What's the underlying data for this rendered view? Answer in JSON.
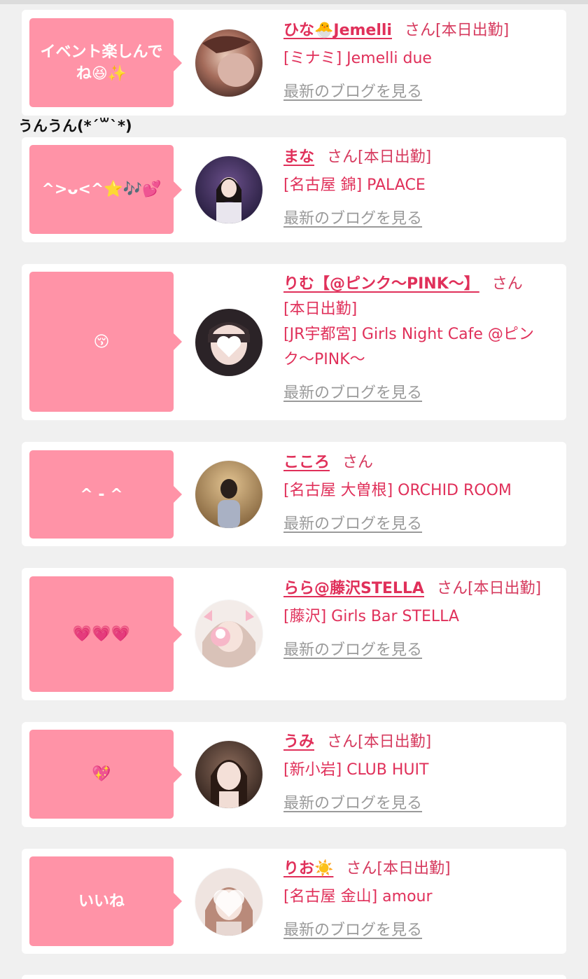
{
  "caption_overlay": "うんうん(*´꒳`*)",
  "san_label": "さん",
  "blog_link_label": "最新のブログを見る",
  "colors": {
    "bubble": "#ff93a7",
    "name": "#e0305a",
    "link_gray": "#9a9a9a",
    "background": "#f0f0f0"
  },
  "cards": [
    {
      "bubble_text": "イベント楽しんでね😆✨",
      "name": "ひな🐣Jemelli",
      "status": "[本日出勤]",
      "shop": "[ミナミ] Jemelli due"
    },
    {
      "bubble_text": "^>ᴗ<^⭐🎶💕",
      "name": "まな",
      "status": "[本日出勤]",
      "shop": "[名古屋 錦] PALACE"
    },
    {
      "bubble_text": "😚",
      "name": "りむ【@ピンク〜PINK〜】",
      "status": "[本日出勤]",
      "shop": "[JR宇都宮] Girls Night Cafe @ピンク〜PINK〜"
    },
    {
      "bubble_text": "^ - ^",
      "name": "こころ",
      "status": "",
      "shop": "[名古屋 大曽根] ORCHID ROOM"
    },
    {
      "bubble_text": "💗💗💗",
      "name": "らら@藤沢STELLA",
      "status": "[本日出勤]",
      "shop": "[藤沢] Girls Bar STELLA"
    },
    {
      "bubble_text": "💖",
      "name": "うみ",
      "status": "[本日出勤]",
      "shop": "[新小岩] CLUB HUIT"
    },
    {
      "bubble_text": "いいね",
      "name": "りお☀️",
      "status": "[本日出勤]",
      "shop": "[名古屋 金山] amour"
    }
  ]
}
